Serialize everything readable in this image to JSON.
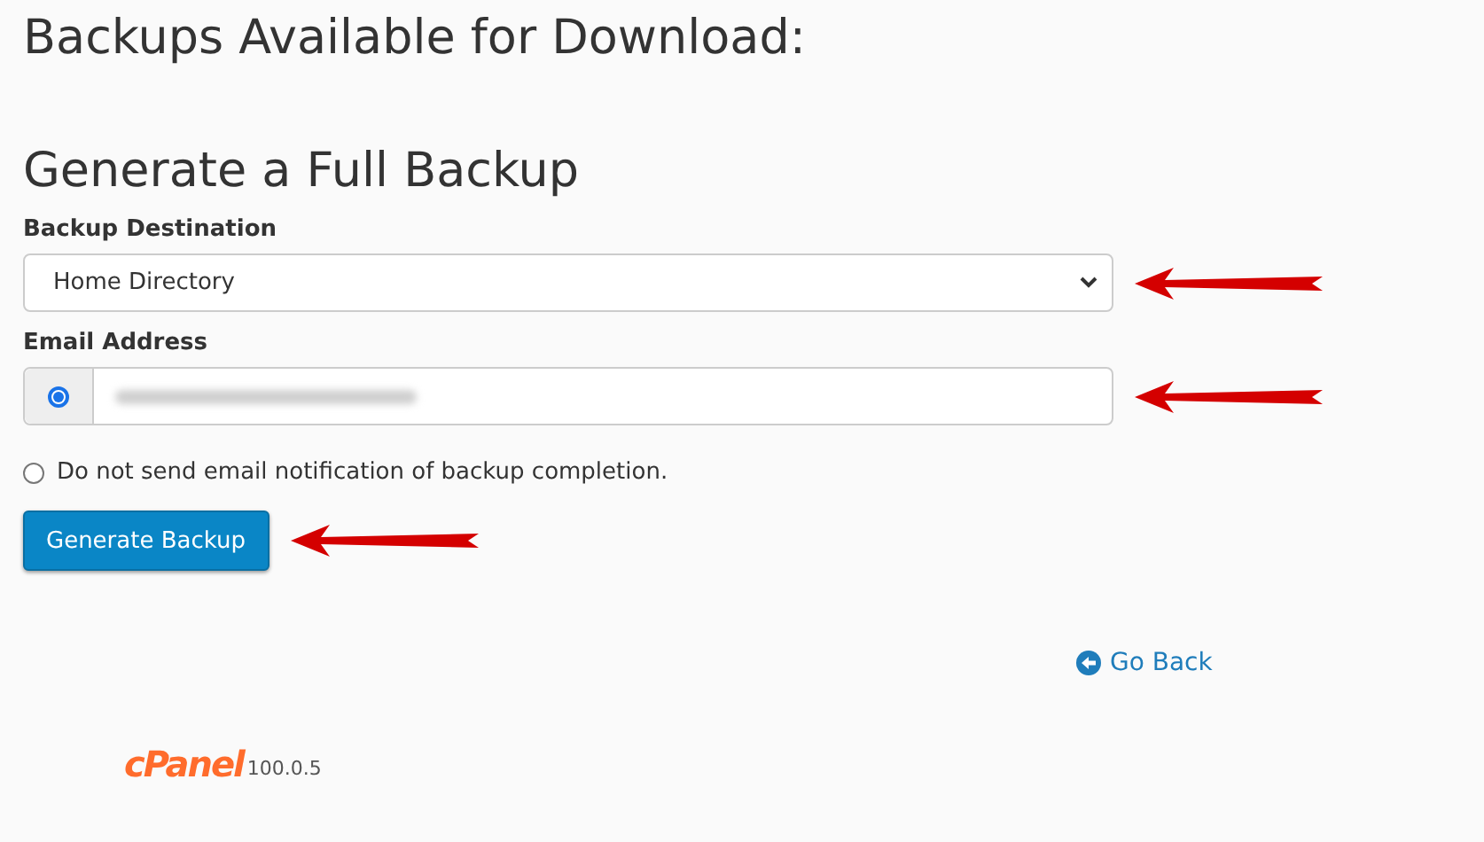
{
  "heading": "Backups Available for Download:",
  "section_title": "Generate a Full Backup",
  "destination": {
    "label": "Backup Destination",
    "value": "Home Directory"
  },
  "email": {
    "label": "Email Address",
    "selected": true
  },
  "no_email_option": {
    "label": "Do not send email notification of backup completion.",
    "selected": false
  },
  "generate_button": "Generate Backup",
  "go_back": "Go Back",
  "footer": {
    "logo": "cPanel",
    "version": "100.0.5"
  }
}
